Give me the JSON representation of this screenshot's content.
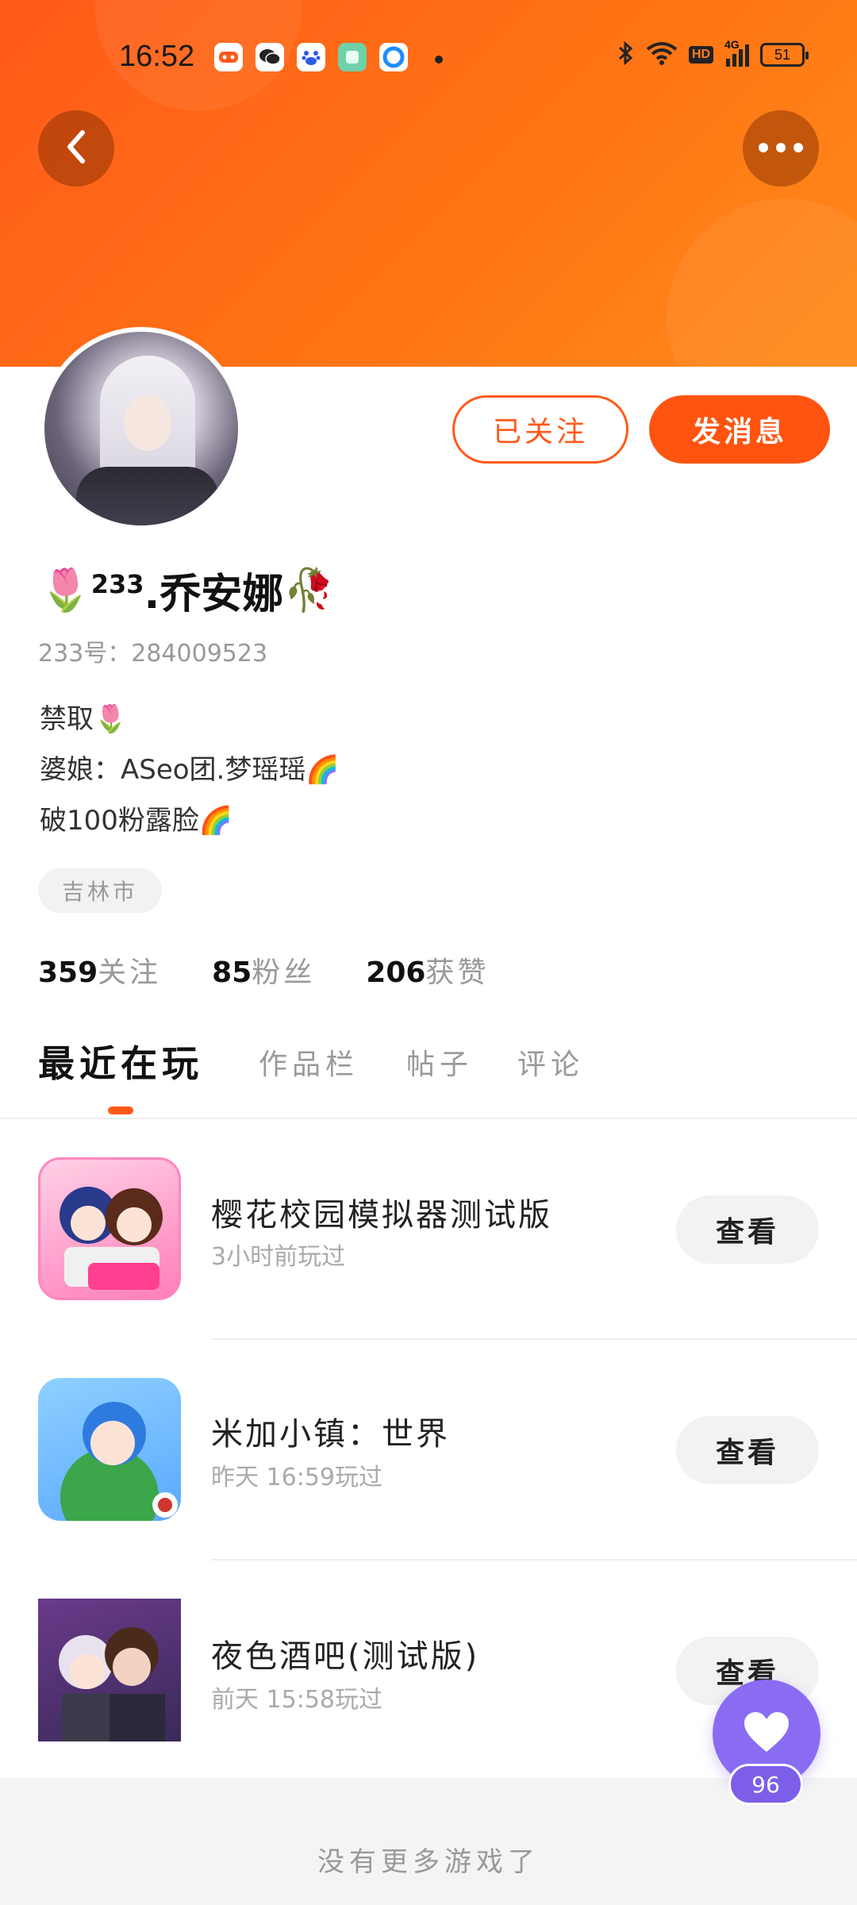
{
  "status_bar": {
    "time": "16:52",
    "network": "4G",
    "hd": "HD",
    "battery": "51"
  },
  "header": {
    "back_icon": "chevron-left-icon",
    "more_icon": "more-horizontal-icon"
  },
  "profile": {
    "name_prefix_emoji": "🌷",
    "name_superscript": "233",
    "name_main": ".乔安娜",
    "name_suffix_emoji": "🥀",
    "user_id": "233号：284009523",
    "bio": [
      "禁取🌷",
      "婆娘：ASeo团.梦瑶瑶🌈",
      "破100粉露脸🌈"
    ],
    "location": "吉林市"
  },
  "actions": {
    "followed_label": "已关注",
    "message_label": "发消息"
  },
  "stats": [
    {
      "value": "359",
      "label": "关注"
    },
    {
      "value": "85",
      "label": "粉丝"
    },
    {
      "value": "206",
      "label": "获赞"
    }
  ],
  "tabs": [
    {
      "label": "最近在玩",
      "active": true
    },
    {
      "label": "作品栏",
      "active": false
    },
    {
      "label": "帖子",
      "active": false
    },
    {
      "label": "评论",
      "active": false
    }
  ],
  "games": [
    {
      "name": "樱花校园模拟器测试版",
      "played": "3小时前玩过",
      "action": "查看"
    },
    {
      "name": "米加小镇：世界",
      "played": "昨天 16:59玩过",
      "action": "查看"
    },
    {
      "name": "夜色酒吧(测试版)",
      "played": "前天 15:58玩过",
      "action": "查看"
    }
  ],
  "footer": {
    "no_more": "没有更多游戏了"
  },
  "like": {
    "count": "96"
  },
  "colors": {
    "brand_orange": "#ff5a1a",
    "like_purple": "#8a6cf2"
  }
}
